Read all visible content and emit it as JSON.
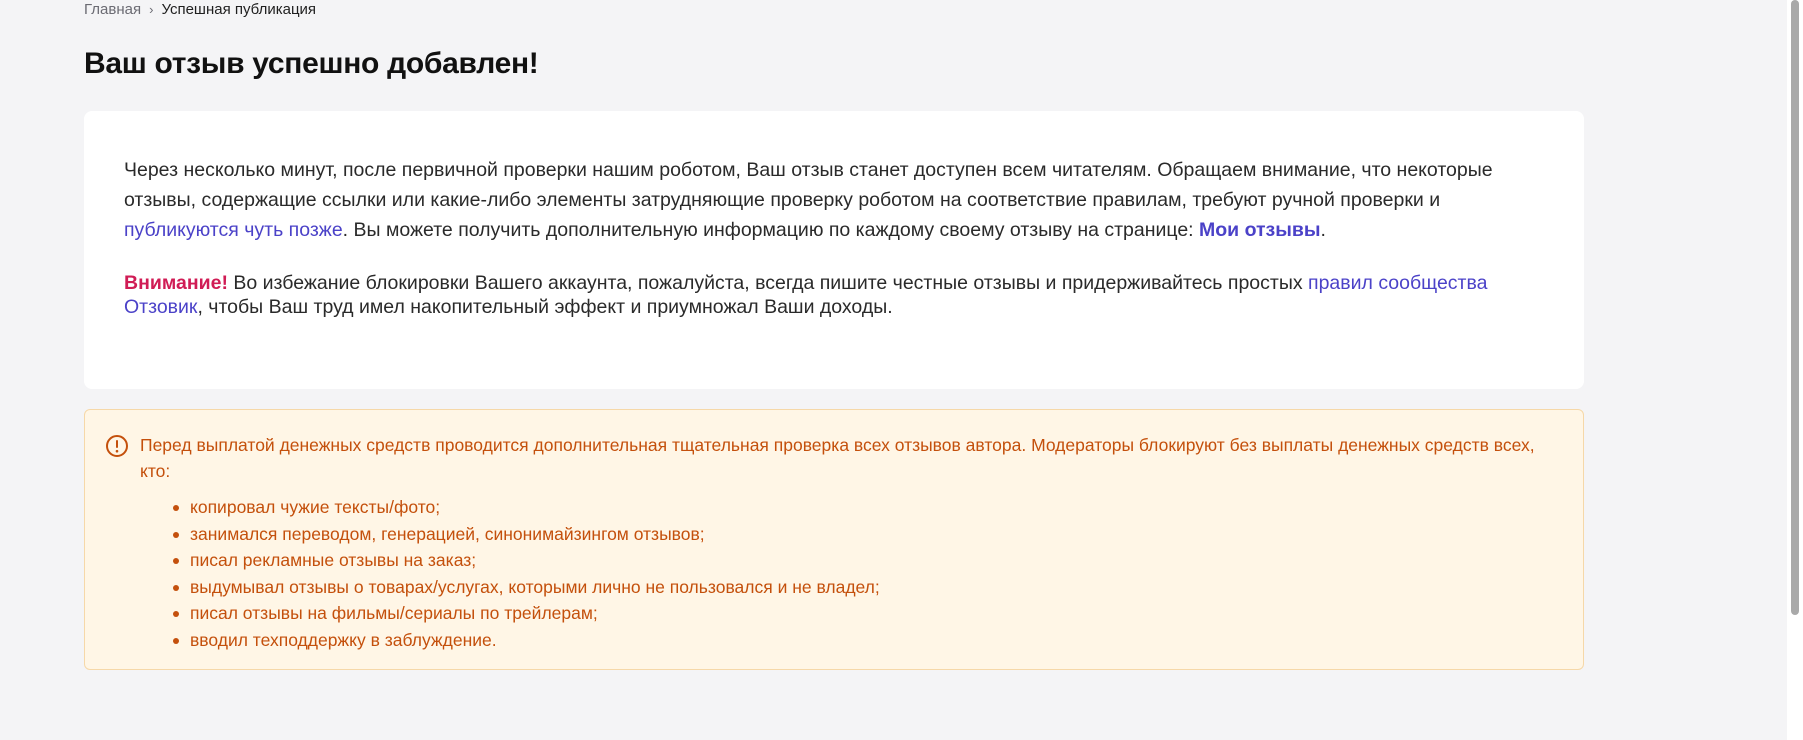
{
  "breadcrumb": {
    "home": "Главная",
    "separator": "›",
    "current": "Успешная публикация"
  },
  "page_title": "Ваш отзыв успешно добавлен!",
  "info_card": {
    "p1_text_a": "Через несколько минут, после первичной проверки нашим роботом, Ваш отзыв станет доступен всем читателям. Обращаем внимание, что некоторые отзывы, содержащие ссылки или какие-либо элементы затрудняющие проверку роботом на соответствие правилам, требуют ручной проверки и ",
    "p1_link": "публикуются чуть позже",
    "p1_text_b": ". Вы можете получить дополнительную информацию по каждому своему отзыву на странице: ",
    "my_reviews_link": "Мои отзывы",
    "p1_end": ".",
    "attention_label": "Внимание!",
    "p2_text_a": " Во избежание блокировки Вашего аккаунта, пожалуйста, всегда пишите честные отзывы и придерживайтесь простых ",
    "rules_link": "правил сообщества Отзовик",
    "p2_text_b": ", чтобы Ваш труд имел накопительный эффект и приумножал Ваши доходы."
  },
  "warning": {
    "icon": "exclamation-circle-icon",
    "intro": "Перед выплатой денежных средств проводится дополнительная тщательная проверка всех отзывов автора. Модераторы блокируют без выплаты денежных средств всех, кто:",
    "items": [
      "копировал чужие тексты/фото;",
      "занимался переводом, генерацией, синонимайзингом отзывов;",
      "писал рекламные отзывы на заказ;",
      "выдумывал отзывы о товарах/услугах, которыми лично не пользовался и не владел;",
      "писал отзывы на фильмы/сериалы по трейлерам;",
      "вводил техподдержку в заблуждение."
    ]
  },
  "colors": {
    "link": "#4b42c8",
    "attention": "#d01c55",
    "warning_text": "#c4500c",
    "warning_bg": "#fff6e6"
  }
}
